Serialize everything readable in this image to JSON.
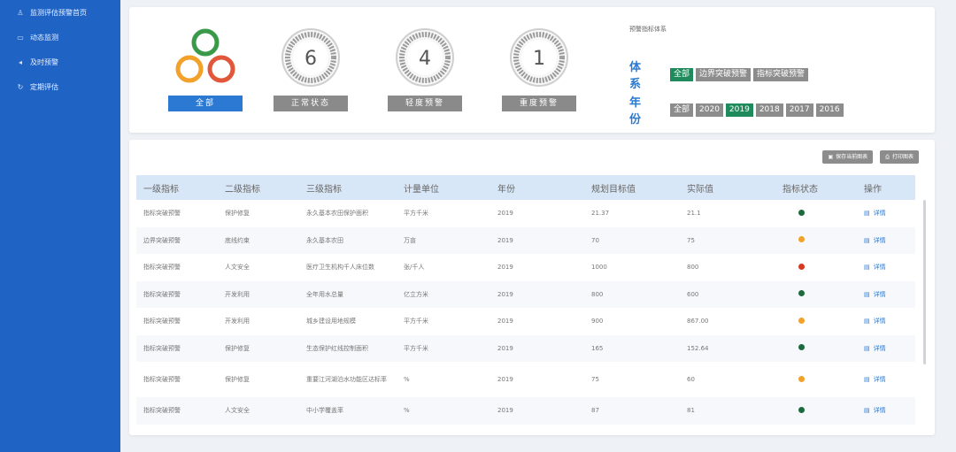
{
  "sidebar": {
    "items": [
      {
        "icon": "user-icon",
        "label": "监测评估预警首页"
      },
      {
        "icon": "monitor-icon",
        "label": "动态监测"
      },
      {
        "icon": "sound-icon",
        "label": "及时预警"
      },
      {
        "icon": "refresh-icon",
        "label": "定期评估"
      }
    ]
  },
  "summary": {
    "all_label": "全部",
    "normal_count": "6",
    "normal_label": "正常状态",
    "mild_count": "4",
    "mild_label": "轻度预警",
    "severe_count": "1",
    "severe_label": "重度预警"
  },
  "filters": {
    "system_title": "预警指标体系",
    "system_label": "体 系",
    "system_options": [
      "全部",
      "边界突破预警",
      "指标突破预警"
    ],
    "year_label": "年 份",
    "year_options": [
      "全部",
      "2020",
      "2019",
      "2018",
      "2017",
      "2016"
    ]
  },
  "toolbar": {
    "save_label": "保存当前图表",
    "print_label": "打印图表"
  },
  "table": {
    "headers": [
      "一级指标",
      "二级指标",
      "三级指标",
      "计量单位",
      "年份",
      "规划目标值",
      "实际值",
      "指标状态",
      "操作"
    ],
    "detail_label": "详情",
    "rows": [
      [
        "指标突破预警",
        "保护修复",
        "永久基本农田保护面积",
        "平方千米",
        "2019",
        "21.37",
        "21.1",
        "green"
      ],
      [
        "边界突破预警",
        "底线约束",
        "永久基本农田",
        "万亩",
        "2019",
        "70",
        "75",
        "orange"
      ],
      [
        "指标突破预警",
        "人文安全",
        "医疗卫生机构千人床位数",
        "张/千人",
        "2019",
        "1000",
        "800",
        "red"
      ],
      [
        "指标突破预警",
        "开发利用",
        "全年用水总量",
        "亿立方米",
        "2019",
        "800",
        "600",
        "green"
      ],
      [
        "指标突破预警",
        "开发利用",
        "城乡建设用地规模",
        "平方千米",
        "2019",
        "900",
        "867.00",
        "orange"
      ],
      [
        "指标突破预警",
        "保护修复",
        "生态保护红线控制面积",
        "平方千米",
        "2019",
        "165",
        "152.64",
        "green"
      ],
      [
        "指标突破预警",
        "保护修复",
        "重要江河湖泊水功能区达标率",
        "%",
        "2019",
        "75",
        "60",
        "orange"
      ],
      [
        "指标突破预警",
        "人文安全",
        "中小学覆盖率",
        "%",
        "2019",
        "87",
        "81",
        "green"
      ]
    ]
  },
  "colors": {
    "green": "#1d6b3c",
    "orange": "#f2a12b",
    "red": "#d9381e",
    "accent": "#2b79d3"
  }
}
